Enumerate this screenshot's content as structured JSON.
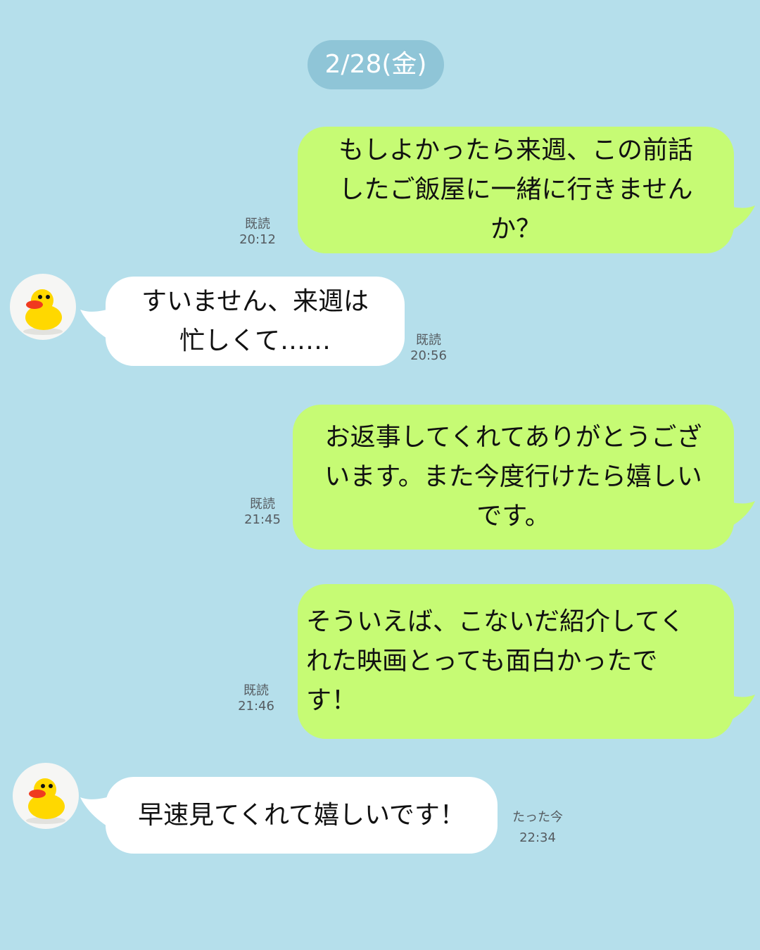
{
  "date_header": "2/28(金)",
  "messages": [
    {
      "side": "sent",
      "text": "もしよかったら来週、この前話\nしたご飯屋に一緒に行きません\nか？",
      "read": "既読",
      "time": "20:12"
    },
    {
      "side": "received",
      "text": "すいません、来週は\n忙しくて……",
      "read": "既読",
      "time": "20:56"
    },
    {
      "side": "sent",
      "text": "お返事してくれてありがとうござ\nいます。また今度行けたら嬉しい\nです。",
      "read": "既読",
      "time": "21:45"
    },
    {
      "side": "sent",
      "text": "そういえば、こないだ紹介してく\nれた映画とっても面白かったで\nす！",
      "read": "既読",
      "time": "21:46"
    },
    {
      "side": "received",
      "text": "早速見てくれて嬉しいです！",
      "read": "たった今",
      "time": "22:34"
    }
  ],
  "avatar_icon": "rubber-duck-icon",
  "colors": {
    "background": "#b5dfeb",
    "sent_bubble": "#c6fb74",
    "received_bubble": "#ffffff",
    "date_pill": "#8fc5d7"
  }
}
